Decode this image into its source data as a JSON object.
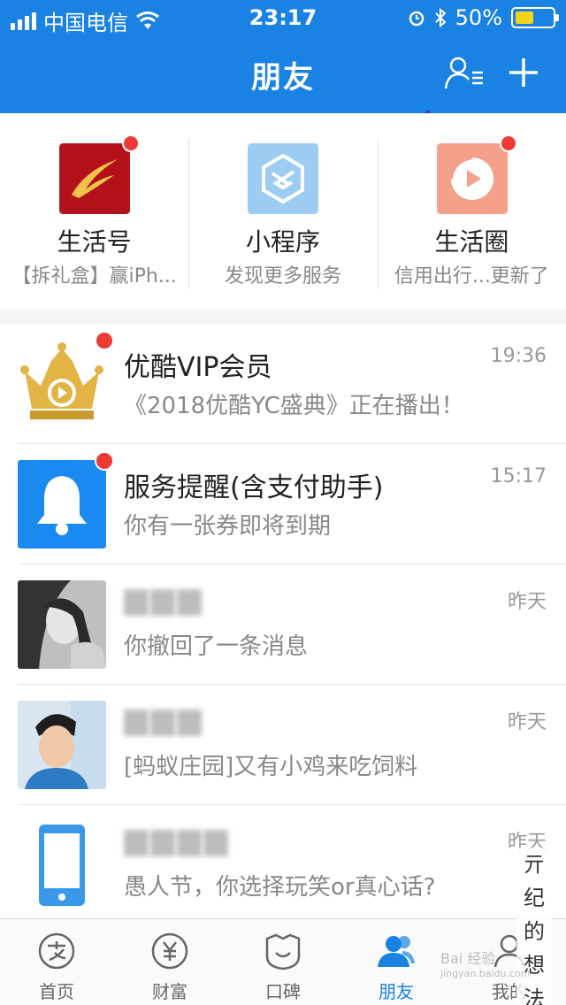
{
  "status_bar": {
    "carrier": "中国电信",
    "time": "23:17",
    "battery_percent": "50%",
    "battery_level": 0.5
  },
  "header": {
    "title": "朋友",
    "bg_color": "#1a82e2"
  },
  "apps": [
    {
      "title": "生活号",
      "subtitle": "【拆礼盒】赢iPh...",
      "icon": "life-account-icon",
      "has_dot": true,
      "color": "#c8141b"
    },
    {
      "title": "小程序",
      "subtitle": "发现更多服务",
      "icon": "mini-program-icon",
      "has_dot": false,
      "color": "#9cccf2"
    },
    {
      "title": "生活圈",
      "subtitle": "信用出行...更新了",
      "icon": "life-circle-icon",
      "has_dot": true,
      "color": "#f4a08a"
    }
  ],
  "messages": [
    {
      "title": "优酷VIP会员",
      "subtitle": "《2018优酷YC盛典》正在播出！",
      "time": "19:36",
      "avatar": "youku-crown-icon",
      "has_dot": true
    },
    {
      "title": "服务提醒(含支付助手)",
      "subtitle": "你有一张券即将到期",
      "time": "15:17",
      "avatar": "bell-icon",
      "has_dot": true
    },
    {
      "title": "",
      "subtitle": "你撤回了一条消息",
      "time": "昨天",
      "avatar": "user-photo-woman",
      "has_dot": false
    },
    {
      "title": "",
      "subtitle": "[蚂蚁庄园]又有小鸡来吃饲料",
      "time": "昨天",
      "avatar": "user-photo-boy",
      "has_dot": false
    },
    {
      "title": "",
      "subtitle": "愚人节，你选择玩笑or真心话?",
      "time": "昨天",
      "avatar": "phone-icon",
      "has_dot": false
    }
  ],
  "tabs": [
    {
      "label": "首页",
      "icon": "alipay-home-icon",
      "active": false
    },
    {
      "label": "财富",
      "icon": "wealth-yen-icon",
      "active": false
    },
    {
      "label": "口碑",
      "icon": "koubei-icon",
      "active": false
    },
    {
      "label": "朋友",
      "icon": "friends-icon",
      "active": true
    },
    {
      "label": "我的",
      "icon": "me-icon",
      "active": false
    }
  ],
  "watermark": {
    "lines": [
      "亓",
      "纪",
      "的",
      "想",
      "法"
    ],
    "baidu": "Bai 经验",
    "baidu_url": "jingyan.baidu.com"
  }
}
